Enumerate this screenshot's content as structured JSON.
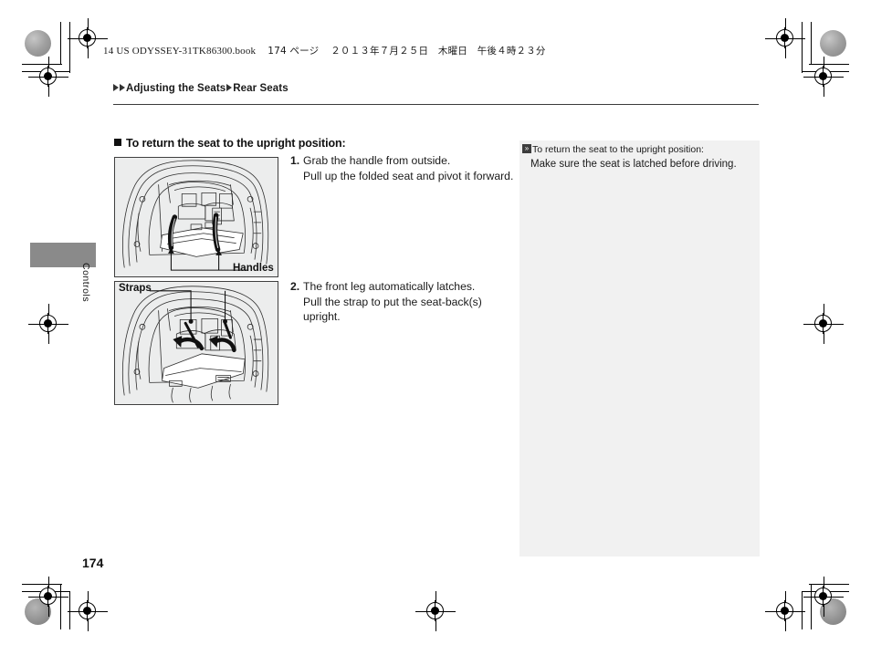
{
  "document": {
    "print_header": "14 US ODYSSEY-31TK86300.book",
    "print_header_page": "174 ページ",
    "print_header_date": "２０１３年７月２５日　木曜日　午後４時２３分",
    "page_number": "174"
  },
  "breadcrumb": {
    "level1": "Adjusting the Seats",
    "level2": "Rear Seats"
  },
  "side_tab": {
    "label": "Controls"
  },
  "section": {
    "heading": "To return the seat to the upright position:"
  },
  "figures": [
    {
      "id": "figure-1",
      "caption": "Handles",
      "alt": "Cargo area with folded third-row seat and two pull handles"
    },
    {
      "id": "figure-2",
      "caption": "Straps",
      "alt": "Cargo area showing straps being pulled to raise the seat-backs"
    }
  ],
  "steps": [
    {
      "number": "1.",
      "line1": "Grab the handle from outside.",
      "line2": "Pull up the folded seat and pivot it forward."
    },
    {
      "number": "2.",
      "line1": "The front leg automatically latches.",
      "line2": "Pull the strap to put the seat-back(s)",
      "line3": "upright."
    }
  ],
  "info_panel": {
    "icon_glyph": "»",
    "title": "To return the seat to the upright position:",
    "body": "Make sure the seat is latched before driving."
  },
  "colors": {
    "panel_bg": "#f1f1f1",
    "figure_bg": "#eceded",
    "tab_gray": "#8a8a8a",
    "text": "#1a1a1a"
  }
}
